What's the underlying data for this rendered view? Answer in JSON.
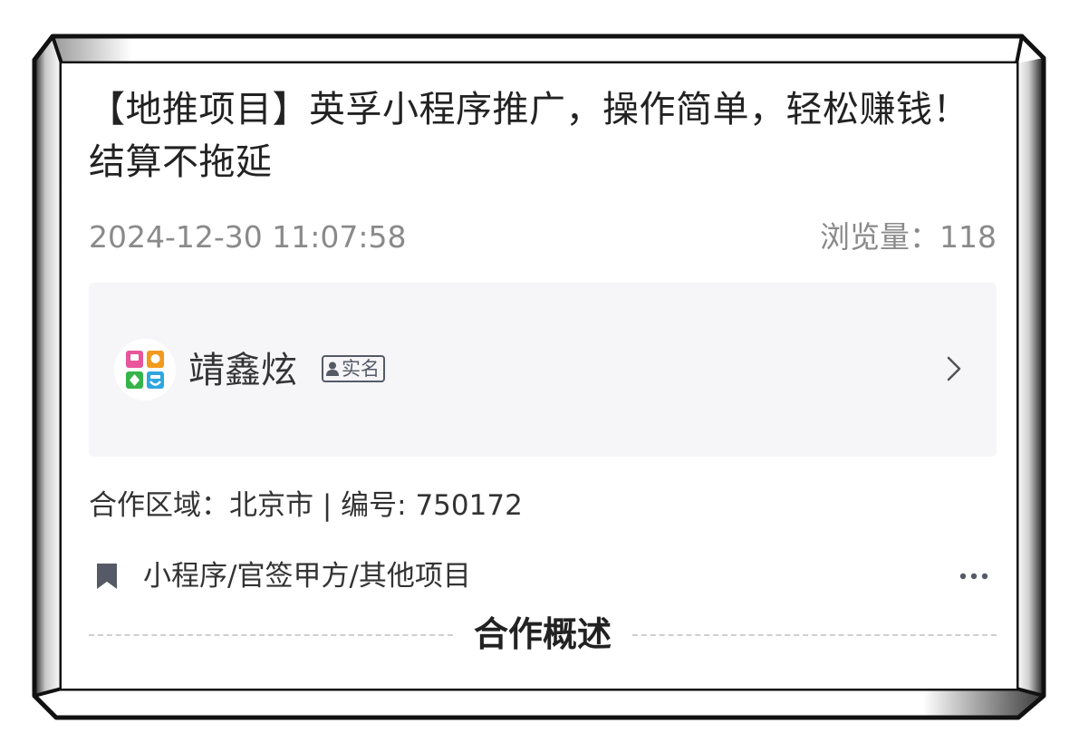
{
  "post": {
    "title": "【地推项目】英孚小程序推广，操作简单，轻松赚钱！结算不拖延",
    "date": "2024-12-30 11:07:58",
    "views_label": "浏览量：118"
  },
  "author": {
    "name": "靖鑫炫",
    "badge": "实名",
    "avatar_icon": "avatar-logo-icon",
    "chevron_icon": "chevron-right-icon"
  },
  "info": {
    "region_line": "合作区域：北京市 | 编号: 750172"
  },
  "tags": {
    "path": "小程序/官签甲方/其他项目",
    "bookmark_icon": "bookmark-icon",
    "more_icon": "more-dots-icon"
  },
  "section": {
    "title": "合作概述"
  },
  "colors": {
    "text_primary": "#222222",
    "text_secondary": "#8a8a8a",
    "author_card_bg": "#f6f6f9",
    "icon_gray": "#555a66",
    "avatar_pink": "#e8559a",
    "avatar_orange": "#f39a1e",
    "avatar_green": "#35b44a",
    "avatar_blue": "#2fa6df"
  }
}
